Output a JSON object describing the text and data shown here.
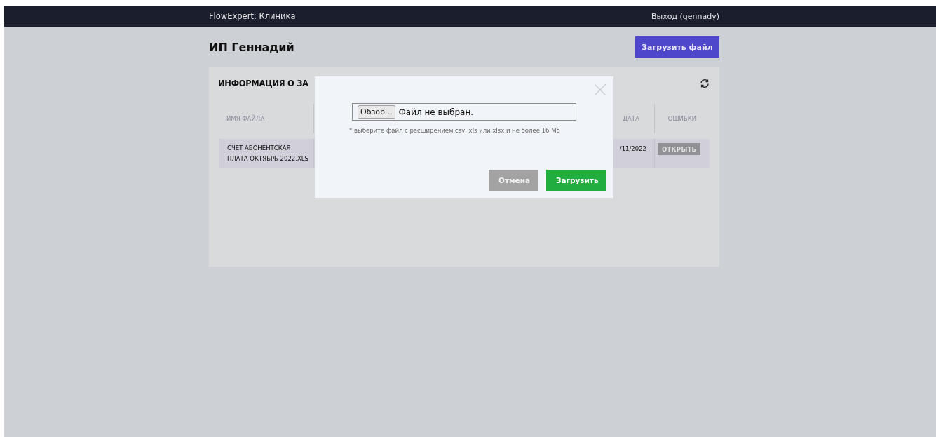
{
  "top_bar": {
    "brand": "FlowExpert: Клиника",
    "logout": "Выход (gennady)"
  },
  "page": {
    "title": "ИП Геннадий",
    "upload_button": "Загрузить файл"
  },
  "card": {
    "title": "ИНФОРМАЦИЯ О ЗА",
    "table": {
      "columns": [
        "ИМЯ ФАЙЛА",
        "ДАТА",
        "ОШИБКИ"
      ],
      "rows": [
        {
          "file_name": "СЧЕТ АБОНЕНТСКАЯ ПЛАТА ОКТЯБРЬ 2022.XLS",
          "date": "/11/2022",
          "errors_button": "ОТКРЫТЬ"
        }
      ]
    }
  },
  "dialog": {
    "browse_button": "Обзор...",
    "file_status": "Файл не выбран.",
    "hint": "* выберите файл с расширением csv, xls или xlsx и не более 16 Мб",
    "buttons": [
      {
        "label": "Отмена",
        "kind": "cancel"
      },
      {
        "label": "Загрузить",
        "kind": "primary"
      }
    ]
  }
}
